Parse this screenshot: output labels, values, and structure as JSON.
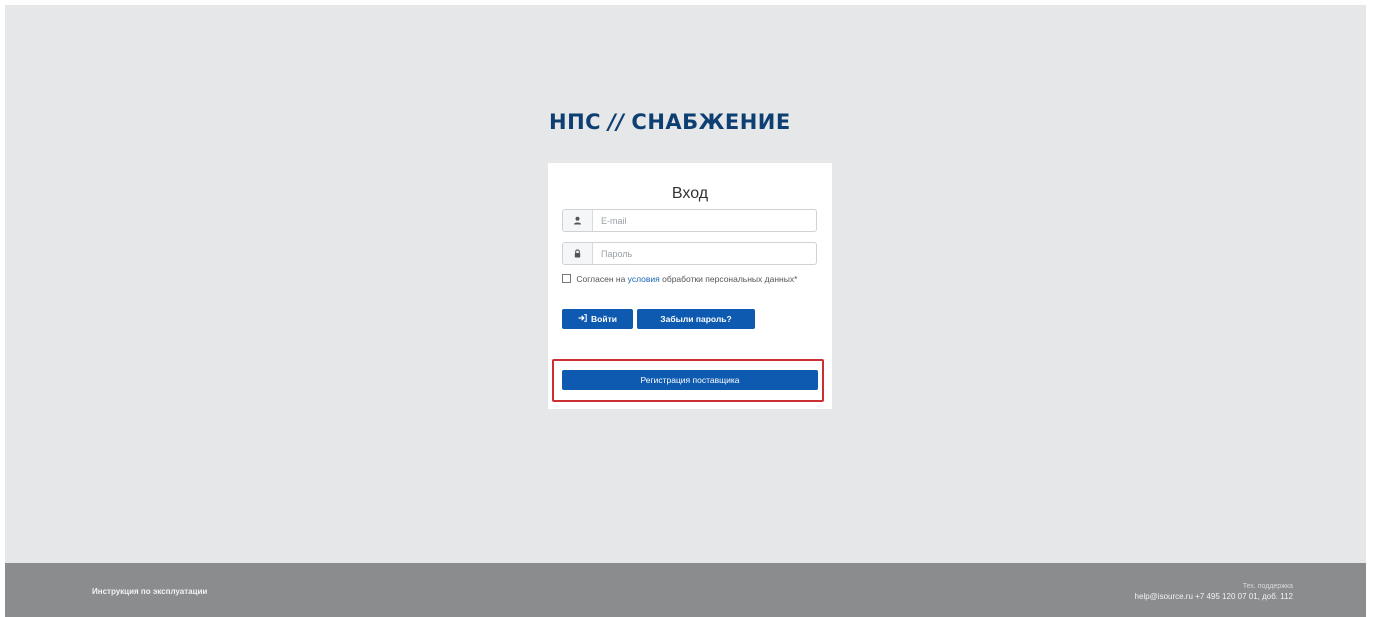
{
  "logo": {
    "left": "НПС",
    "separator": "//",
    "right": "СНАБЖЕНИЕ"
  },
  "login": {
    "title": "Вход",
    "email_placeholder": "E-mail",
    "password_placeholder": "Пароль",
    "agree_prefix": "Согласен на",
    "agree_link": "условия",
    "agree_suffix": "обработки персональных данных*",
    "login_button": "Войти",
    "forgot_button": "Забыли пароль?",
    "register_button": "Регистрация поставщика"
  },
  "footer": {
    "manual_link": "Инструкция по эксплуатации",
    "support_label": "Тех. поддержка",
    "support_contact": "help@isource.ru +7 495 120 07 01, доб. 112"
  },
  "icons": {
    "email": "user-icon",
    "password": "lock-icon",
    "login": "sign-in-icon"
  },
  "colors": {
    "brand": "#0e3f73",
    "button": "#0d5ab0",
    "highlight": "#cc2f33",
    "footer": "#8a8c8e",
    "background": "#e6e7e8"
  }
}
